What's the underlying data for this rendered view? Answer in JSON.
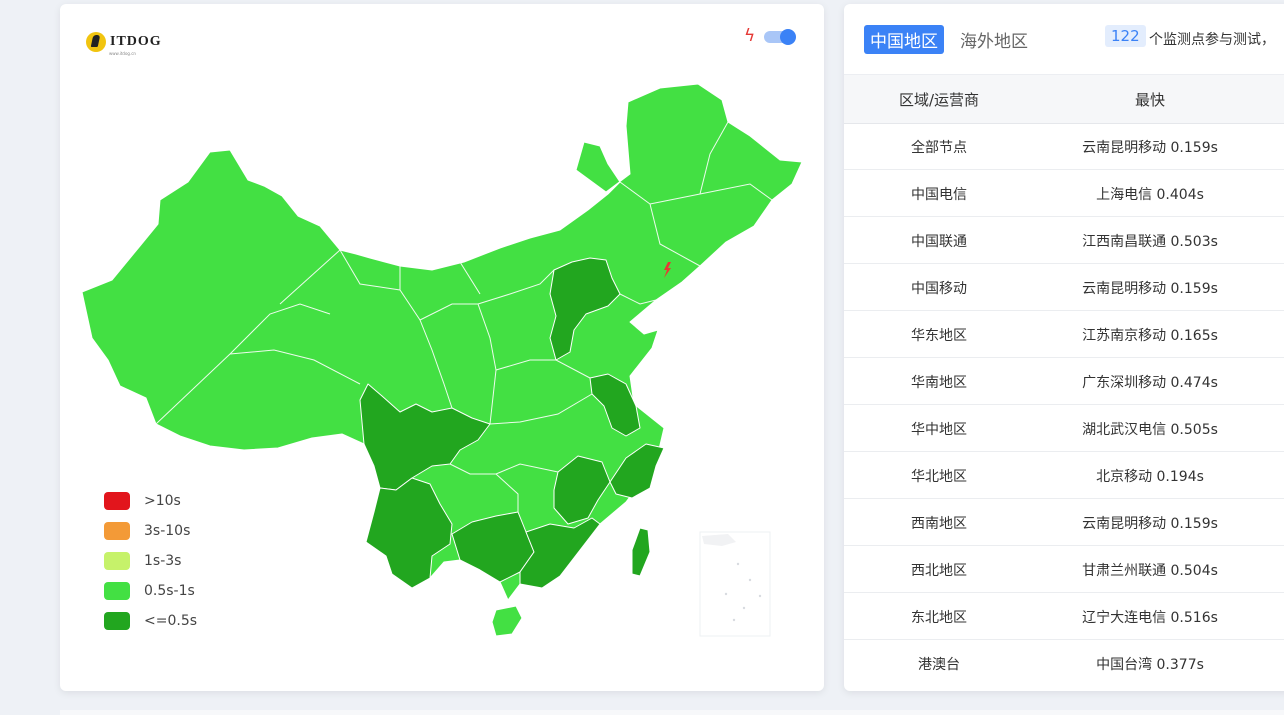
{
  "map": {
    "logo_text": "ITDOG",
    "logo_url": "www.itdog.cn",
    "legend": [
      {
        "label": ">10s",
        "color": "#e2151c"
      },
      {
        "label": "3s-10s",
        "color": "#f39a37"
      },
      {
        "label": "1s-3s",
        "color": "#c6f26a"
      },
      {
        "label": "0.5s-1s",
        "color": "#43e043"
      },
      {
        "label": "<=0.5s",
        "color": "#22a61f"
      }
    ],
    "colors": {
      "light_green": "#43e043",
      "dark_green": "#22a61f",
      "bolt": "#e53935"
    }
  },
  "panel": {
    "tabs": [
      {
        "label": "中国地区",
        "active": true
      },
      {
        "label": "海外地区",
        "active": false
      }
    ],
    "node_count": "122",
    "count_text": "个监测点参与测试，",
    "headers": [
      "区域/运营商",
      "最快"
    ],
    "rows": [
      {
        "region": "全部节点",
        "fastest": "云南昆明移动 0.159s"
      },
      {
        "region": "中国电信",
        "fastest": "上海电信 0.404s"
      },
      {
        "region": "中国联通",
        "fastest": "江西南昌联通 0.503s"
      },
      {
        "region": "中国移动",
        "fastest": "云南昆明移动 0.159s"
      },
      {
        "region": "华东地区",
        "fastest": "江苏南京移动 0.165s"
      },
      {
        "region": "华南地区",
        "fastest": "广东深圳移动 0.474s"
      },
      {
        "region": "华中地区",
        "fastest": "湖北武汉电信 0.505s"
      },
      {
        "region": "华北地区",
        "fastest": "北京移动 0.194s"
      },
      {
        "region": "西南地区",
        "fastest": "云南昆明移动 0.159s"
      },
      {
        "region": "西北地区",
        "fastest": "甘肃兰州联通 0.504s"
      },
      {
        "region": "东北地区",
        "fastest": "辽宁大连电信 0.516s"
      },
      {
        "region": "港澳台",
        "fastest": "中国台湾 0.377s"
      }
    ],
    "accent": "#3b82f6"
  }
}
